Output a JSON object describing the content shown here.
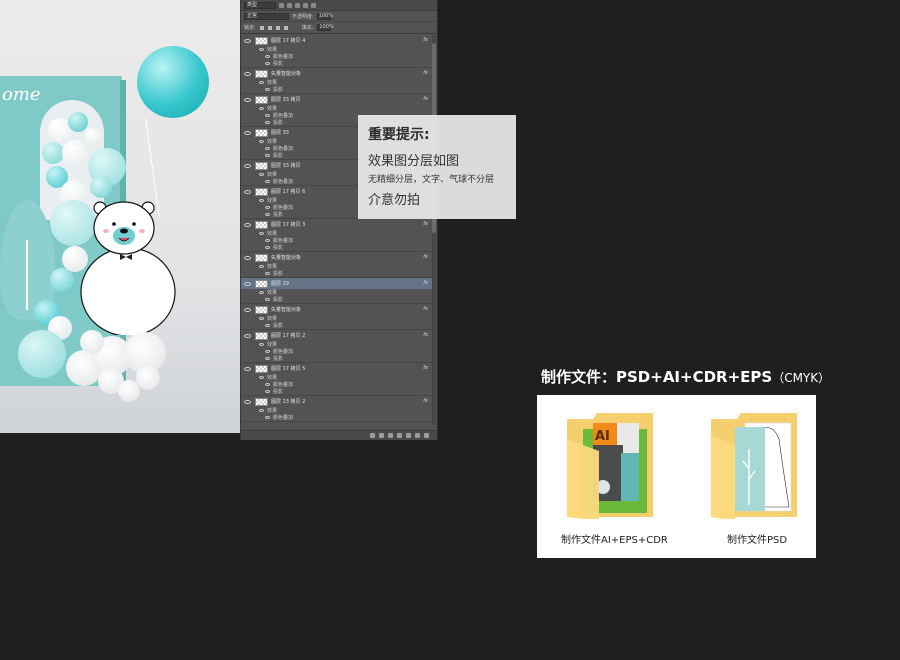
{
  "preview": {
    "welcome_text": "ome"
  },
  "layers_panel": {
    "filter_label": "类型",
    "blend_mode": "正常",
    "opacity_label": "不透明度:",
    "opacity_value": "100%",
    "lock_label": "锁定:",
    "fill_label": "填充:",
    "fill_value": "100%",
    "fx_label": "fx",
    "layers": [
      {
        "name": "图层 17 拷贝 4",
        "subs": [
          "效果",
          "颜色叠加",
          "投影"
        ],
        "selected": false
      },
      {
        "name": "矢量智能对象",
        "subs": [
          "效果",
          "投影"
        ],
        "selected": false
      },
      {
        "name": "图层 33 拷贝",
        "subs": [
          "效果",
          "颜色叠加",
          "投影"
        ],
        "selected": false
      },
      {
        "name": "图层 33",
        "subs": [
          "效果",
          "颜色叠加",
          "投影"
        ],
        "selected": false
      },
      {
        "name": "图层 33 拷贝",
        "subs": [
          "效果",
          "颜色叠加"
        ],
        "selected": false
      },
      {
        "name": "图层 17 拷贝 6",
        "subs": [
          "效果",
          "颜色叠加",
          "投影"
        ],
        "selected": false
      },
      {
        "name": "图层 17 拷贝 3",
        "subs": [
          "效果",
          "颜色叠加",
          "投影"
        ],
        "selected": false
      },
      {
        "name": "矢量智能对象",
        "subs": [
          "效果",
          "投影"
        ],
        "selected": false
      },
      {
        "name": "图层 29",
        "subs": [
          "效果",
          "投影"
        ],
        "selected": true
      },
      {
        "name": "矢量智能对象",
        "subs": [
          "效果",
          "投影"
        ],
        "selected": false
      },
      {
        "name": "图层 17 拷贝 2",
        "subs": [
          "效果",
          "颜色叠加",
          "投影"
        ],
        "selected": false
      },
      {
        "name": "图层 17 拷贝 5",
        "subs": [
          "效果",
          "颜色叠加",
          "投影"
        ],
        "selected": false
      },
      {
        "name": "图层 23 拷贝 2",
        "subs": [
          "效果",
          "颜色叠加"
        ],
        "selected": false
      }
    ]
  },
  "notice": {
    "title": "重要提示:",
    "line1": "效果图分层如图",
    "line2": "无精细分层，文字、气球不分层",
    "line3": "介意勿拍"
  },
  "files": {
    "heading": "制作文件：PSD+AI+CDR+EPS",
    "heading_sub": "（CMYK）",
    "items": [
      {
        "label": "制作文件AI+EPS+CDR",
        "icon": "folder-ai-icon",
        "badge": "AI"
      },
      {
        "label": "制作文件PSD",
        "icon": "folder-psd-icon"
      }
    ]
  },
  "colors": {
    "background": "#1f1f1f",
    "panel": "#535353",
    "selected_layer": "#657387",
    "teal": "#7fc9c6",
    "folder": "#f5cf6e"
  }
}
